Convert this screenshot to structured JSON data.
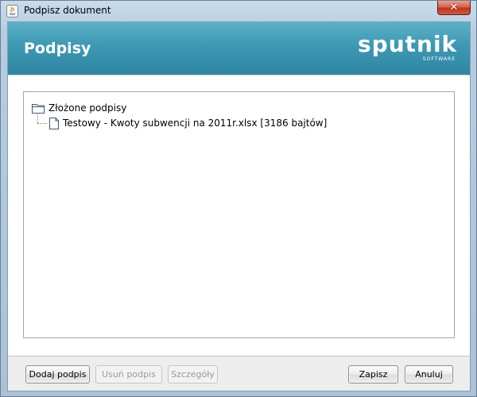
{
  "window": {
    "title": "Podpisz dokument"
  },
  "header": {
    "title": "Podpisy",
    "logo_main": "sputnik",
    "logo_sub": "SOFTWARE"
  },
  "tree": {
    "root_label": "Złożone podpisy",
    "items": [
      {
        "label": "Testowy - Kwoty subwencji na 2011r.xlsx [3186 bajtów]"
      }
    ]
  },
  "buttons": {
    "add": "Dodaj podpis",
    "remove": "Usuń podpis",
    "details": "Szczegóły",
    "save": "Zapisz",
    "cancel": "Anuluj"
  },
  "colors": {
    "header_accent": "#3e98b3",
    "close_button": "#c0351b"
  }
}
